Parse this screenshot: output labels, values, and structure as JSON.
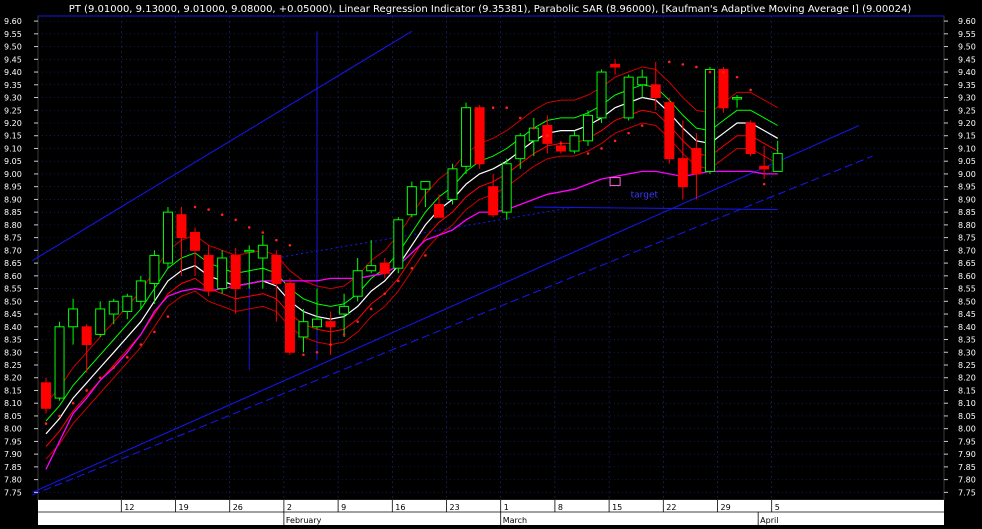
{
  "header": {
    "title": "PT (9.01000, 9.13000, 9.01000, 9.08000, +0.05000), Linear Regression Indicator (9.35381), Parabolic SAR (8.96000), [Kaufman's Adaptive Moving Average I] (9.00024)"
  },
  "annotations": {
    "target_label": "target"
  },
  "colors": {
    "background": "#000000",
    "grid": "#1a2a80",
    "up_candle": "#00ff00",
    "down_candle": "#ff0000",
    "trendlines": "#1515e0",
    "ma_white": "#ffffff",
    "ma_green": "#00ff00",
    "ma_red": "#ff0000",
    "kama": "#ff00ff",
    "sar": "#ff2020"
  },
  "chart_data": {
    "type": "candlestick",
    "title": "PT (9.01000, 9.13000, 9.01000, 9.08000, +0.05000), Linear Regression Indicator (9.35381), Parabolic SAR (8.96000), [Kaufman's Adaptive Moving Average I] (9.00024)",
    "ylim": [
      7.72,
      9.62
    ],
    "y_ticks": [
      "7.75",
      "7.80",
      "7.85",
      "7.90",
      "7.95",
      "8.00",
      "8.05",
      "8.10",
      "8.15",
      "8.20",
      "8.25",
      "8.30",
      "8.35",
      "8.40",
      "8.45",
      "8.50",
      "8.55",
      "8.60",
      "8.65",
      "8.70",
      "8.75",
      "8.80",
      "8.85",
      "8.90",
      "8.95",
      "9.00",
      "9.05",
      "9.10",
      "9.15",
      "9.20",
      "9.25",
      "9.30",
      "9.35",
      "9.40",
      "9.45",
      "9.50",
      "9.55",
      "9.60"
    ],
    "x_day_ticks": [
      {
        "label": "12",
        "bar": 6
      },
      {
        "label": "19",
        "bar": 10
      },
      {
        "label": "26",
        "bar": 14
      },
      {
        "label": "2",
        "bar": 18
      },
      {
        "label": "9",
        "bar": 22
      },
      {
        "label": "16",
        "bar": 26
      },
      {
        "label": "23",
        "bar": 30
      },
      {
        "label": "1",
        "bar": 34
      },
      {
        "label": "8",
        "bar": 38
      },
      {
        "label": "15",
        "bar": 42
      },
      {
        "label": "22",
        "bar": 46
      },
      {
        "label": "29",
        "bar": 50
      },
      {
        "label": "5",
        "bar": 54
      }
    ],
    "x_month_ticks": [
      {
        "label": "February",
        "bar": 18
      },
      {
        "label": "March",
        "bar": 34
      },
      {
        "label": "April",
        "bar": 53
      }
    ],
    "candles": [
      {
        "o": 8.18,
        "h": 8.2,
        "l": 8.06,
        "c": 8.08
      },
      {
        "o": 8.12,
        "h": 8.42,
        "l": 8.11,
        "c": 8.4
      },
      {
        "o": 8.4,
        "h": 8.51,
        "l": 8.33,
        "c": 8.47
      },
      {
        "o": 8.4,
        "h": 8.41,
        "l": 8.22,
        "c": 8.33
      },
      {
        "o": 8.37,
        "h": 8.5,
        "l": 8.36,
        "c": 8.47
      },
      {
        "o": 8.45,
        "h": 8.51,
        "l": 8.41,
        "c": 8.5
      },
      {
        "o": 8.46,
        "h": 8.53,
        "l": 8.43,
        "c": 8.52
      },
      {
        "o": 8.5,
        "h": 8.6,
        "l": 8.47,
        "c": 8.58
      },
      {
        "o": 8.57,
        "h": 8.7,
        "l": 8.49,
        "c": 8.68
      },
      {
        "o": 8.65,
        "h": 8.87,
        "l": 8.63,
        "c": 8.85
      },
      {
        "o": 8.84,
        "h": 8.87,
        "l": 8.6,
        "c": 8.75
      },
      {
        "o": 8.77,
        "h": 8.79,
        "l": 8.6,
        "c": 8.7
      },
      {
        "o": 8.68,
        "h": 8.72,
        "l": 8.52,
        "c": 8.54
      },
      {
        "o": 8.55,
        "h": 8.7,
        "l": 8.53,
        "c": 8.67
      },
      {
        "o": 8.68,
        "h": 8.71,
        "l": 8.45,
        "c": 8.55
      },
      {
        "o": 8.7,
        "h": 8.72,
        "l": 8.55,
        "c": 8.7
      },
      {
        "o": 8.67,
        "h": 8.76,
        "l": 8.55,
        "c": 8.72
      },
      {
        "o": 8.68,
        "h": 8.7,
        "l": 8.42,
        "c": 8.57
      },
      {
        "o": 8.57,
        "h": 8.59,
        "l": 8.29,
        "c": 8.3
      },
      {
        "o": 8.36,
        "h": 8.47,
        "l": 8.3,
        "c": 8.42
      },
      {
        "o": 8.4,
        "h": 8.55,
        "l": 8.39,
        "c": 8.43
      },
      {
        "o": 8.42,
        "h": 8.46,
        "l": 8.29,
        "c": 8.4
      },
      {
        "o": 8.45,
        "h": 8.53,
        "l": 8.36,
        "c": 8.48
      },
      {
        "o": 8.52,
        "h": 8.67,
        "l": 8.5,
        "c": 8.62
      },
      {
        "o": 8.62,
        "h": 8.74,
        "l": 8.61,
        "c": 8.64
      },
      {
        "o": 8.65,
        "h": 8.67,
        "l": 8.59,
        "c": 8.61
      },
      {
        "o": 8.63,
        "h": 8.83,
        "l": 8.61,
        "c": 8.82
      },
      {
        "o": 8.84,
        "h": 8.97,
        "l": 8.83,
        "c": 8.95
      },
      {
        "o": 8.94,
        "h": 8.97,
        "l": 8.87,
        "c": 8.97
      },
      {
        "o": 8.88,
        "h": 8.92,
        "l": 8.83,
        "c": 8.83
      },
      {
        "o": 8.9,
        "h": 9.04,
        "l": 8.88,
        "c": 9.02
      },
      {
        "o": 9.03,
        "h": 9.28,
        "l": 9.0,
        "c": 9.26
      },
      {
        "o": 9.26,
        "h": 9.27,
        "l": 9.02,
        "c": 9.04
      },
      {
        "o": 8.95,
        "h": 9.0,
        "l": 8.83,
        "c": 8.84
      },
      {
        "o": 8.85,
        "h": 9.06,
        "l": 8.82,
        "c": 9.04
      },
      {
        "o": 9.06,
        "h": 9.16,
        "l": 9.02,
        "c": 9.15
      },
      {
        "o": 9.13,
        "h": 9.22,
        "l": 9.07,
        "c": 9.18
      },
      {
        "o": 9.19,
        "h": 9.23,
        "l": 9.08,
        "c": 9.12
      },
      {
        "o": 9.11,
        "h": 9.13,
        "l": 9.08,
        "c": 9.09
      },
      {
        "o": 9.09,
        "h": 9.17,
        "l": 9.08,
        "c": 9.15
      },
      {
        "o": 9.13,
        "h": 9.25,
        "l": 9.11,
        "c": 9.23
      },
      {
        "o": 9.22,
        "h": 9.41,
        "l": 9.2,
        "c": 9.4
      },
      {
        "o": 9.43,
        "h": 9.45,
        "l": 9.39,
        "c": 9.42
      },
      {
        "o": 9.22,
        "h": 9.39,
        "l": 9.21,
        "c": 9.38
      },
      {
        "o": 9.35,
        "h": 9.41,
        "l": 9.3,
        "c": 9.38
      },
      {
        "o": 9.35,
        "h": 9.44,
        "l": 9.25,
        "c": 9.3
      },
      {
        "o": 9.28,
        "h": 9.3,
        "l": 9.04,
        "c": 9.06
      },
      {
        "o": 9.06,
        "h": 9.21,
        "l": 8.9,
        "c": 8.95
      },
      {
        "o": 9.1,
        "h": 9.16,
        "l": 8.9,
        "c": 9.0
      },
      {
        "o": 9.01,
        "h": 9.42,
        "l": 9.0,
        "c": 9.41
      },
      {
        "o": 9.41,
        "h": 9.42,
        "l": 9.24,
        "c": 9.26
      },
      {
        "o": 9.3,
        "h": 9.31,
        "l": 9.26,
        "c": 9.3
      },
      {
        "o": 9.2,
        "h": 9.21,
        "l": 9.07,
        "c": 9.08
      },
      {
        "o": 9.03,
        "h": 9.11,
        "l": 8.98,
        "c": 9.02
      },
      {
        "o": 9.01,
        "h": 9.13,
        "l": 9.01,
        "c": 9.08
      }
    ],
    "series": [
      {
        "name": "Linear Regression Indicator",
        "values": [
          7.98,
          8.04,
          8.12,
          8.18,
          8.24,
          8.3,
          8.36,
          8.42,
          8.5,
          8.58,
          8.62,
          8.64,
          8.6,
          8.58,
          8.56,
          8.57,
          8.58,
          8.56,
          8.5,
          8.46,
          8.44,
          8.43,
          8.44,
          8.48,
          8.54,
          8.58,
          8.64,
          8.72,
          8.8,
          8.86,
          8.9,
          8.96,
          9.0,
          9.02,
          9.05,
          9.09,
          9.13,
          9.16,
          9.17,
          9.17,
          9.19,
          9.22,
          9.26,
          9.28,
          9.3,
          9.29,
          9.24,
          9.18,
          9.13,
          9.12,
          9.16,
          9.2,
          9.2,
          9.17,
          9.14
        ]
      },
      {
        "name": "Kaufman's Adaptive Moving Average",
        "values": [
          7.84,
          7.95,
          8.06,
          8.12,
          8.19,
          8.24,
          8.3,
          8.37,
          8.46,
          8.52,
          8.54,
          8.55,
          8.54,
          8.55,
          8.56,
          8.57,
          8.58,
          8.58,
          8.58,
          8.58,
          8.58,
          8.59,
          8.59,
          8.59,
          8.6,
          8.61,
          8.64,
          8.69,
          8.74,
          8.76,
          8.78,
          8.82,
          8.85,
          8.85,
          8.86,
          8.88,
          8.9,
          8.92,
          8.93,
          8.94,
          8.96,
          8.98,
          8.99,
          9.0,
          9.01,
          9.01,
          9.0,
          8.99,
          9.0,
          9.01,
          9.01,
          9.01,
          9.01,
          9.0,
          9.0
        ]
      }
    ],
    "sar": [
      {
        "bar": 0,
        "v": 8.02
      },
      {
        "bar": 1,
        "v": 8.05
      },
      {
        "bar": 2,
        "v": 8.1
      },
      {
        "bar": 3,
        "v": 8.15
      },
      {
        "bar": 4,
        "v": 8.2
      },
      {
        "bar": 5,
        "v": 8.24
      },
      {
        "bar": 6,
        "v": 8.28
      },
      {
        "bar": 7,
        "v": 8.33
      },
      {
        "bar": 8,
        "v": 8.38
      },
      {
        "bar": 9,
        "v": 8.44
      },
      {
        "bar": 11,
        "v": 8.87
      },
      {
        "bar": 12,
        "v": 8.86
      },
      {
        "bar": 13,
        "v": 8.84
      },
      {
        "bar": 14,
        "v": 8.82
      },
      {
        "bar": 15,
        "v": 8.79
      },
      {
        "bar": 16,
        "v": 8.77
      },
      {
        "bar": 17,
        "v": 8.74
      },
      {
        "bar": 18,
        "v": 8.72
      },
      {
        "bar": 19,
        "v": 8.29
      },
      {
        "bar": 20,
        "v": 8.3
      },
      {
        "bar": 21,
        "v": 8.33
      },
      {
        "bar": 22,
        "v": 8.37
      },
      {
        "bar": 23,
        "v": 8.42
      },
      {
        "bar": 24,
        "v": 8.47
      },
      {
        "bar": 25,
        "v": 8.53
      },
      {
        "bar": 26,
        "v": 8.58
      },
      {
        "bar": 27,
        "v": 8.63
      },
      {
        "bar": 28,
        "v": 8.68
      },
      {
        "bar": 33,
        "v": 9.26
      },
      {
        "bar": 34,
        "v": 9.26
      },
      {
        "bar": 35,
        "v": 9.22
      },
      {
        "bar": 36,
        "v": 9.18
      },
      {
        "bar": 37,
        "v": 9.15
      },
      {
        "bar": 38,
        "v": 9.12
      },
      {
        "bar": 40,
        "v": 9.08
      },
      {
        "bar": 41,
        "v": 9.1
      },
      {
        "bar": 42,
        "v": 9.13
      },
      {
        "bar": 43,
        "v": 9.16
      },
      {
        "bar": 44,
        "v": 9.19
      },
      {
        "bar": 46,
        "v": 9.44
      },
      {
        "bar": 47,
        "v": 9.43
      },
      {
        "bar": 48,
        "v": 9.42
      },
      {
        "bar": 49,
        "v": 9.4
      },
      {
        "bar": 50,
        "v": 9.4
      },
      {
        "bar": 51,
        "v": 9.38
      },
      {
        "bar": 52,
        "v": 9.33
      },
      {
        "bar": 53,
        "v": 8.96
      }
    ],
    "trendlines": [
      {
        "from": {
          "bar": -1,
          "v": 8.66
        },
        "to": {
          "bar": 27,
          "v": 9.56
        }
      },
      {
        "from": {
          "bar": -1,
          "v": 7.75
        },
        "to": {
          "bar": 60,
          "v": 9.19
        }
      },
      {
        "from": {
          "bar": -1,
          "v": 7.74
        },
        "to": {
          "bar": 61,
          "v": 9.07
        }
      },
      {
        "from": {
          "bar": 36,
          "v": 8.87
        },
        "to": {
          "bar": 54,
          "v": 8.86
        }
      },
      {
        "from": {
          "bar": 17,
          "v": 8.67
        },
        "to": {
          "bar": 39,
          "v": 8.87
        }
      }
    ],
    "vlines": [
      {
        "bar": 15,
        "from": 8.23,
        "to": 8.7
      },
      {
        "bar": 20,
        "from": 8.27,
        "to": 9.56
      }
    ],
    "box_markers": [
      {
        "bar": 42,
        "v": 8.97
      }
    ]
  }
}
